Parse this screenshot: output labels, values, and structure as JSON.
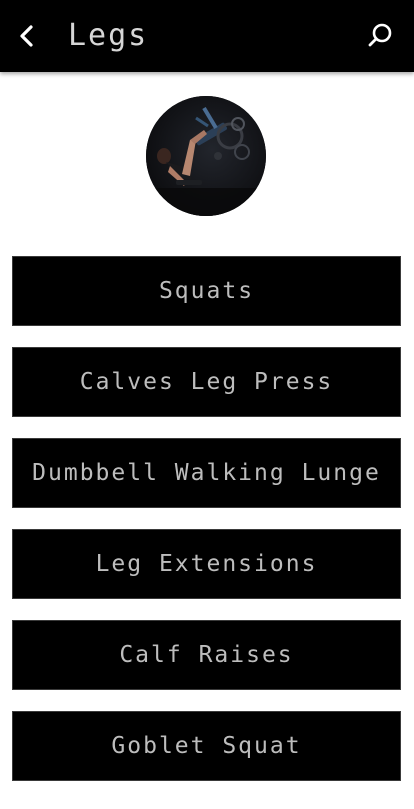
{
  "header": {
    "title": "Legs",
    "back_icon": "chevron-left-icon",
    "search_icon": "search-icon"
  },
  "colors": {
    "bar_background": "#000000",
    "page_background": "#ffffff",
    "button_background": "#000000",
    "button_text": "#bdbdbd",
    "title_text": "#d6d6d6"
  },
  "exercises": [
    {
      "label": "Squats"
    },
    {
      "label": "Calves Leg Press"
    },
    {
      "label": "Dumbbell Walking Lunge"
    },
    {
      "label": "Leg Extensions"
    },
    {
      "label": "Calf Raises"
    },
    {
      "label": "Goblet Squat"
    }
  ]
}
